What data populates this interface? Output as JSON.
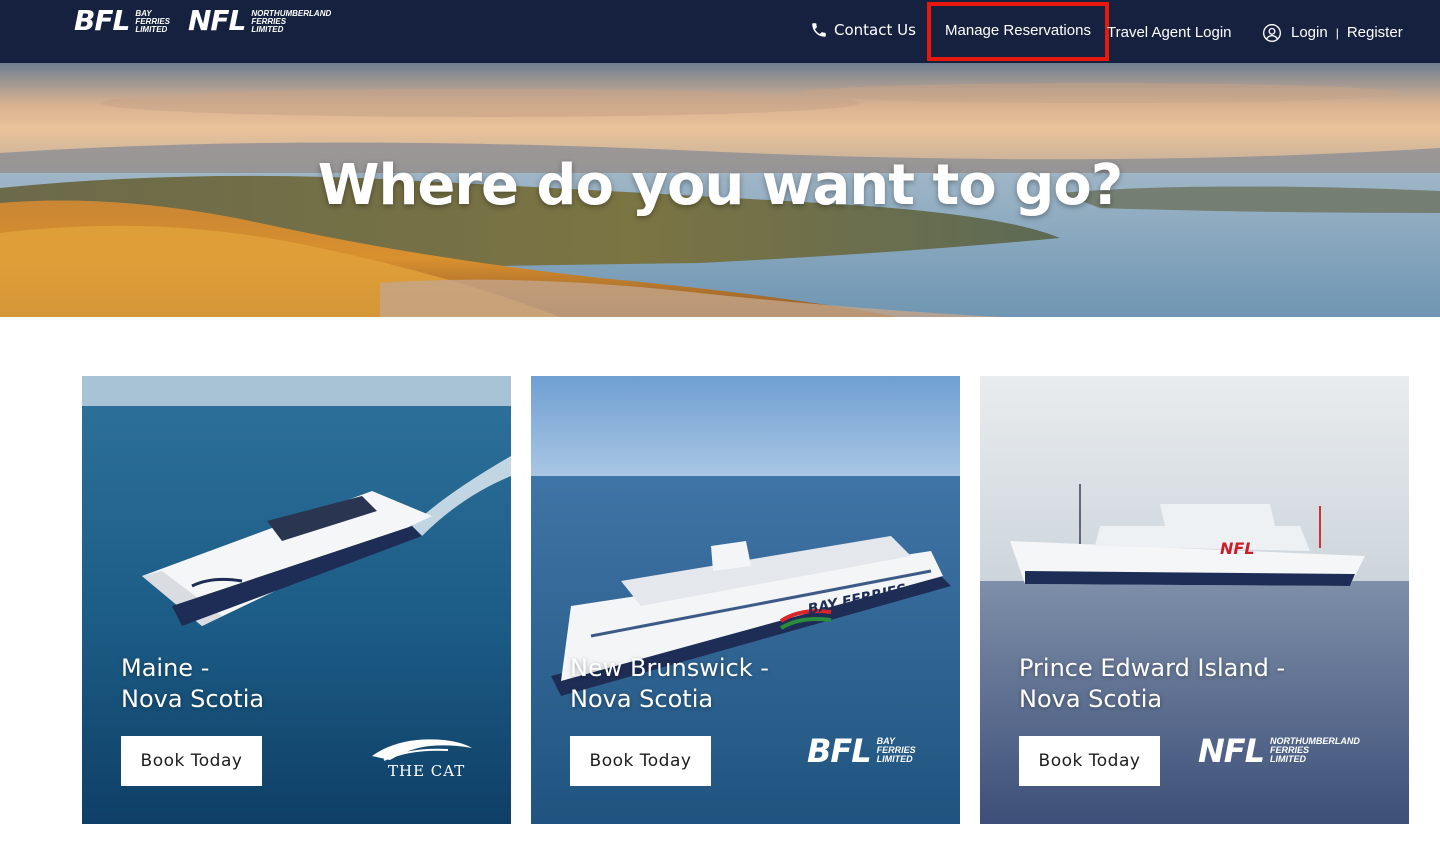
{
  "header": {
    "brand_bfl": {
      "mark": "BFL",
      "sub": [
        "Bay",
        "Ferries",
        "Limited"
      ]
    },
    "brand_nfl": {
      "mark": "NFL",
      "sub": [
        "Northumberland",
        "Ferries",
        "Limited"
      ]
    },
    "nav": {
      "contact": "Contact Us",
      "manage": "Manage Reservations",
      "agent": "Travel Agent Login",
      "login": "Login",
      "separator": "|",
      "register": "Register"
    }
  },
  "hero": {
    "title": "Where do you want to go?"
  },
  "cards": [
    {
      "route_line1": "Maine -",
      "route_line2": "Nova Scotia",
      "button": "Book Today",
      "logo": "THE CAT",
      "ship_label": "THE CAT"
    },
    {
      "route_line1": "New Brunswick -",
      "route_line2": "Nova Scotia",
      "button": "Book Today",
      "logo_mark": "BFL",
      "logo_sub": [
        "Bay",
        "Ferries",
        "Limited"
      ],
      "ship_label": "BAY FERRIES"
    },
    {
      "route_line1": "Prince Edward Island -",
      "route_line2": "Nova Scotia",
      "button": "Book Today",
      "logo_mark": "NFL",
      "logo_sub": [
        "Northumberland",
        "Ferries",
        "Limited"
      ],
      "ship_label": "NFL"
    }
  ],
  "colors": {
    "header_bg": "#16213f",
    "highlight": "#e8180c",
    "button_bg": "#ffffff"
  },
  "icons": {
    "phone": "phone-icon",
    "user": "user-circle-icon"
  }
}
